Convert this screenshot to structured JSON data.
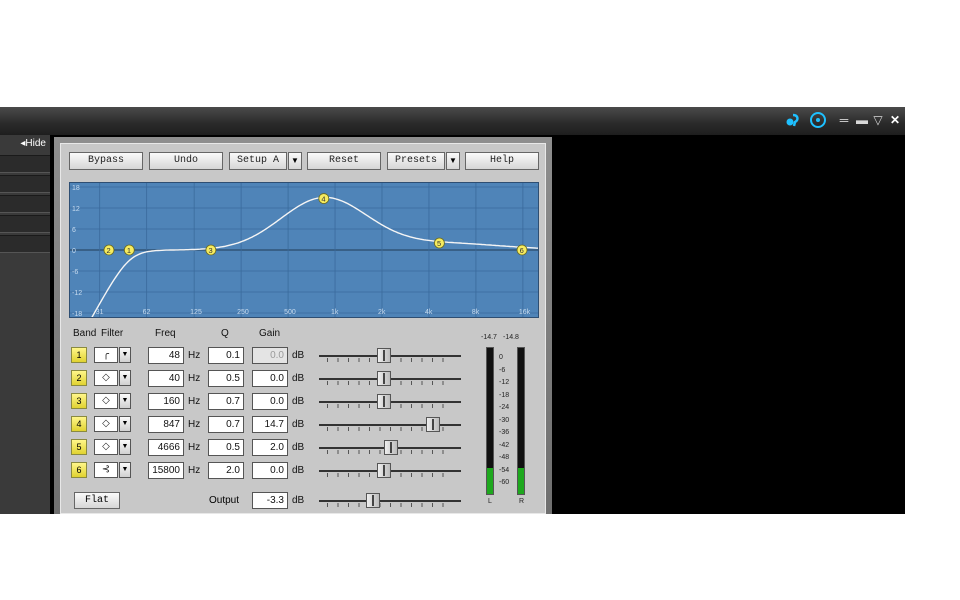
{
  "sidebar": {
    "hide_label": "◂Hide"
  },
  "titlebar_icons": {
    "logo1": "audio-logo-icon",
    "logo2": "power-icon",
    "menu": "menu-icon",
    "minimize": "minimize-icon",
    "dropdown": "dropdown-icon",
    "close": "close-icon"
  },
  "toolbar": {
    "bypass": "Bypass",
    "undo": "Undo",
    "setup": "Setup A",
    "reset": "Reset",
    "presets": "Presets",
    "help": "Help"
  },
  "graph": {
    "y_ticks": [
      "18",
      "12",
      "6",
      "0",
      "-6",
      "-12",
      "-18"
    ],
    "x_ticks": [
      "31",
      "62",
      "125",
      "250",
      "500",
      "1k",
      "2k",
      "4k",
      "8k",
      "16k"
    ],
    "colors": {
      "background": "#4f84b8",
      "grid": "#3a6a9c",
      "curve": "#f5f5f5",
      "marker": "#f6ec60"
    },
    "markers": [
      "1",
      "2",
      "3",
      "4",
      "5",
      "6"
    ]
  },
  "headers": {
    "band": "Band",
    "filter": "Filter",
    "freq": "Freq",
    "q": "Q",
    "gain": "Gain"
  },
  "bands": [
    {
      "num": "1",
      "filter": "╭",
      "freq": "48",
      "hz": "Hz",
      "q": "0.1",
      "gain": "0.0",
      "db": "dB",
      "gain_disabled": true,
      "slider_gain_db": 0.0
    },
    {
      "num": "2",
      "filter": "◇",
      "freq": "40",
      "hz": "Hz",
      "q": "0.5",
      "gain": "0.0",
      "db": "dB",
      "gain_disabled": false,
      "slider_gain_db": 0.0
    },
    {
      "num": "3",
      "filter": "◇",
      "freq": "160",
      "hz": "Hz",
      "q": "0.7",
      "gain": "0.0",
      "db": "dB",
      "gain_disabled": false,
      "slider_gain_db": 0.0
    },
    {
      "num": "4",
      "filter": "◇",
      "freq": "847",
      "hz": "Hz",
      "q": "0.7",
      "gain": "14.7",
      "db": "dB",
      "gain_disabled": false,
      "slider_gain_db": 14.7
    },
    {
      "num": "5",
      "filter": "◇",
      "freq": "4666",
      "hz": "Hz",
      "q": "0.5",
      "gain": "2.0",
      "db": "dB",
      "gain_disabled": false,
      "slider_gain_db": 2.0
    },
    {
      "num": "6",
      "filter": "⊰",
      "freq": "15800",
      "hz": "Hz",
      "q": "2.0",
      "gain": "0.0",
      "db": "dB",
      "gain_disabled": false,
      "slider_gain_db": 0.0
    }
  ],
  "output": {
    "label": "Output",
    "value": "-3.3",
    "db": "dB",
    "slider_gain_db": -3.3
  },
  "flat_label": "Flat",
  "meters": {
    "peak_left": "-14.7",
    "peak_right": "-14.8",
    "scale": [
      "0",
      "-6",
      "-12",
      "-18",
      "-24",
      "-30",
      "-36",
      "-42",
      "-48",
      "-54",
      "-60"
    ],
    "left_label": "L",
    "right_label": "R",
    "level_left": 0.18,
    "level_right": 0.18
  }
}
